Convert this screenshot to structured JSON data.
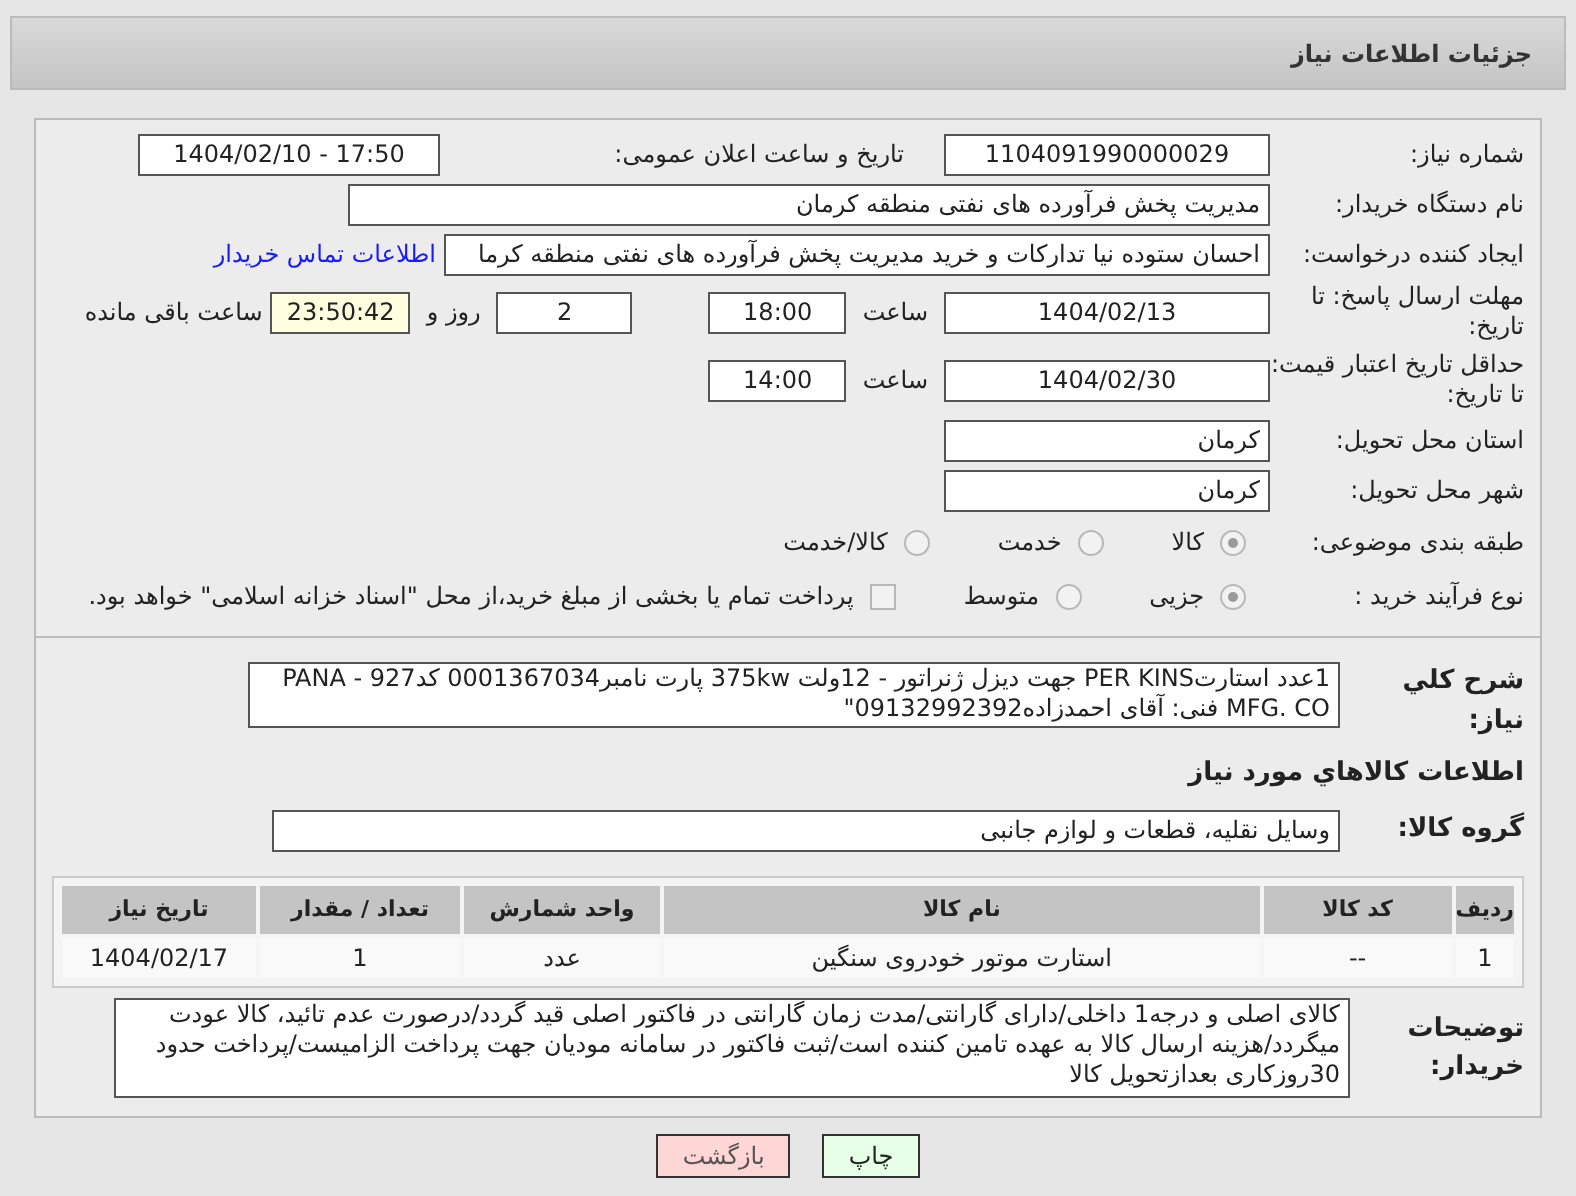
{
  "page_title": "جزئیات اطلاعات نیاز",
  "need_number": {
    "label": "شماره نیاز:",
    "value": "1104091990000029"
  },
  "announce": {
    "label": "تاریخ و ساعت اعلان عمومی:",
    "value": "1404/02/10 - 17:50"
  },
  "buyer_org": {
    "label": "نام دستگاه خریدار:",
    "value": "مدیریت پخش فرآورده های نفتی منطقه کرمان"
  },
  "requester": {
    "label": "ایجاد کننده درخواست:",
    "value": "احسان  ستوده نیا  تدارکات و خرید  مدیریت پخش فرآورده های نفتی منطقه کرما",
    "link": "اطلاعات تماس خریدار"
  },
  "reply_deadline": {
    "label": "مهلت ارسال پاسخ: تا تاریخ:",
    "date": "1404/02/13",
    "time_label": "ساعت",
    "time": "18:00",
    "days": "2",
    "days_label": "روز و",
    "remaining": "23:50:42",
    "remaining_label": "ساعت باقی مانده"
  },
  "price_validity": {
    "label": "حداقل تاریخ اعتبار قیمت: تا تاریخ:",
    "date": "1404/02/30",
    "time_label": "ساعت",
    "time": "14:00"
  },
  "province": {
    "label": "استان محل تحویل:",
    "value": "کرمان"
  },
  "city": {
    "label": "شهر محل تحویل:",
    "value": "کرمان"
  },
  "category": {
    "label": "طبقه بندی موضوعی:",
    "options": [
      {
        "label": "کالا",
        "selected": true
      },
      {
        "label": "خدمت",
        "selected": false
      },
      {
        "label": "کالا/خدمت",
        "selected": false
      }
    ]
  },
  "process": {
    "label": "نوع فرآیند خرید :",
    "options": [
      {
        "label": "جزیی",
        "selected": true
      },
      {
        "label": "متوسط",
        "selected": false
      }
    ],
    "treasury": {
      "label": "پرداخت تمام یا بخشی از مبلغ خرید،از محل \"اسناد خزانه اسلامی\" خواهد بود.",
      "checked": false
    }
  },
  "description": {
    "label": "شرح کلي نياز:",
    "value": "1عدد استارتPER KINS جهت دیزل ژنراتور - 12ولت 375kw پارت نامبر0001367034 کد927 - PANA MFG. CO فنی: آقای احمدزاده09132992392\""
  },
  "goods_heading": "اطلاعات کالاهاي مورد نياز",
  "goods_group": {
    "label": "گروه کالا:",
    "value": "وسایل نقلیه، قطعات و لوازم جانبی"
  },
  "table": {
    "columns": [
      "ردیف",
      "کد کالا",
      "نام کالا",
      "واحد شمارش",
      "تعداد / مقدار",
      "تاریخ نیاز"
    ],
    "rows": [
      [
        "1",
        "--",
        "استارت موتور خودروی سنگین",
        "عدد",
        "1",
        "1404/02/17"
      ]
    ]
  },
  "buyer_notes": {
    "label": "توضیحات خریدار:",
    "value": "کالای اصلی و درجه1 داخلی/دارای گارانتی/مدت زمان گارانتی در فاکتور اصلی قید گردد/درصورت عدم تائید، کالا عودت میگردد/هزینه ارسال کالا به عهده تامین کننده است/ثبت فاکتور در سامانه مودیان جهت پرداخت الزامیست/پرداخت حدود 30روزکاری بعدازتحویل کالا"
  },
  "buttons": [
    {
      "label": "چاپ",
      "kind": "print"
    },
    {
      "label": "بازگشت",
      "kind": "back"
    }
  ]
}
